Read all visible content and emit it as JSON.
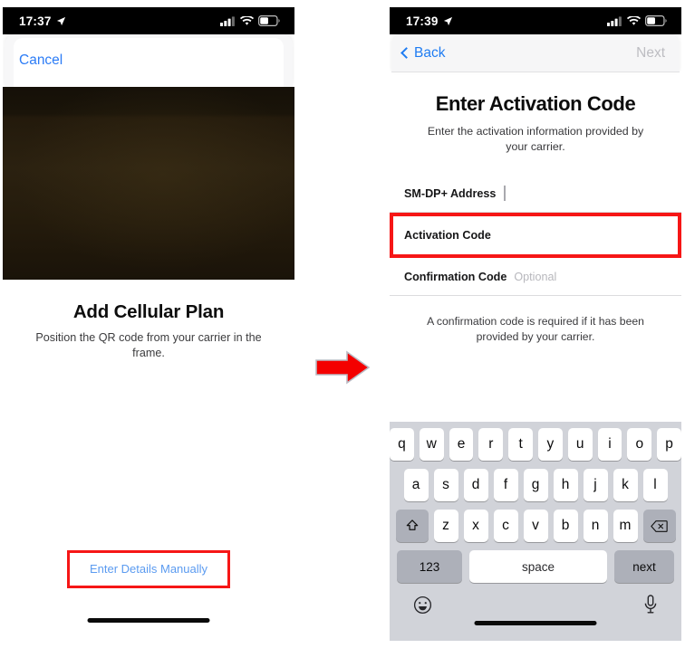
{
  "left_phone": {
    "status_bar": {
      "time": "17:37",
      "location_icon": "location-arrow-icon",
      "signal_icon": "cellular-signal-icon",
      "wifi_icon": "wifi-icon",
      "battery_icon": "battery-icon"
    },
    "sheet": {
      "cancel_label": "Cancel"
    },
    "camera": {
      "viewfinder_name": "qr-camera-viewfinder"
    },
    "title": "Add Cellular Plan",
    "subtitle": "Position the QR code from your carrier in the frame.",
    "manual_link": "Enter Details Manually",
    "highlight_color": "#f61616"
  },
  "arrow": {
    "name": "flow-arrow-icon",
    "color": "#f40000"
  },
  "right_phone": {
    "status_bar": {
      "time": "17:39",
      "location_icon": "location-arrow-icon",
      "signal_icon": "cellular-signal-icon",
      "wifi_icon": "wifi-icon",
      "battery_icon": "battery-icon"
    },
    "nav": {
      "back_label": "Back",
      "next_label": "Next"
    },
    "title": "Enter Activation Code",
    "subtitle": "Enter the activation information provided by your carrier.",
    "fields": [
      {
        "label": "SM-DP+ Address",
        "placeholder": "",
        "value": "",
        "focused": true,
        "highlighted": false
      },
      {
        "label": "Activation Code",
        "placeholder": "",
        "value": "",
        "focused": false,
        "highlighted": true
      },
      {
        "label": "Confirmation Code",
        "placeholder": "Optional",
        "value": "",
        "focused": false,
        "highlighted": false
      }
    ],
    "note": "A confirmation code is required if it has been provided by your carrier.",
    "highlight_color": "#f61616",
    "keyboard": {
      "row1": [
        "q",
        "w",
        "e",
        "r",
        "t",
        "y",
        "u",
        "i",
        "o",
        "p"
      ],
      "row2": [
        "a",
        "s",
        "d",
        "f",
        "g",
        "h",
        "j",
        "k",
        "l"
      ],
      "row3": [
        "z",
        "x",
        "c",
        "v",
        "b",
        "n",
        "m"
      ],
      "shift_icon": "shift-key-icon",
      "backspace_icon": "backspace-key-icon",
      "numbers_label": "123",
      "space_label": "space",
      "return_label": "next",
      "emoji_icon": "emoji-key-icon",
      "mic_icon": "microphone-key-icon"
    }
  }
}
